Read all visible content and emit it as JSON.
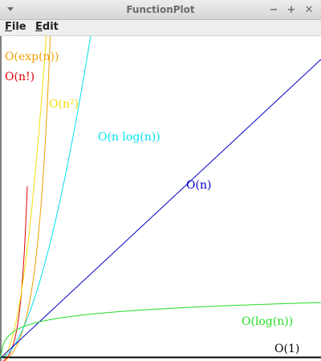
{
  "window": {
    "title": "FunctionPlot",
    "menu_icon": "chevron-down-icon",
    "controls": [
      {
        "name": "minimize-button",
        "glyph": "−"
      },
      {
        "name": "maximize-button",
        "glyph": "+"
      },
      {
        "name": "close-button",
        "glyph": "✕"
      }
    ]
  },
  "menubar": {
    "items": [
      {
        "name": "menu-file",
        "mnemonic": "F",
        "rest": "ile"
      },
      {
        "name": "menu-edit",
        "mnemonic": "E",
        "rest": "dit"
      }
    ]
  },
  "plot": {
    "functions": [
      {
        "label": "O(exp(n))",
        "color": "#f0a000"
      },
      {
        "label": "O(n!)",
        "color": "#e00000"
      },
      {
        "label": "O(n²)",
        "color": "#f5e000"
      },
      {
        "label": "O(n log(n))",
        "color": "#00e0f0"
      },
      {
        "label": "O(n)",
        "color": "#0000c8"
      },
      {
        "label": "O(log(n))",
        "color": "#22dd22"
      },
      {
        "label": "O(1)",
        "color": "#000000"
      }
    ]
  }
}
